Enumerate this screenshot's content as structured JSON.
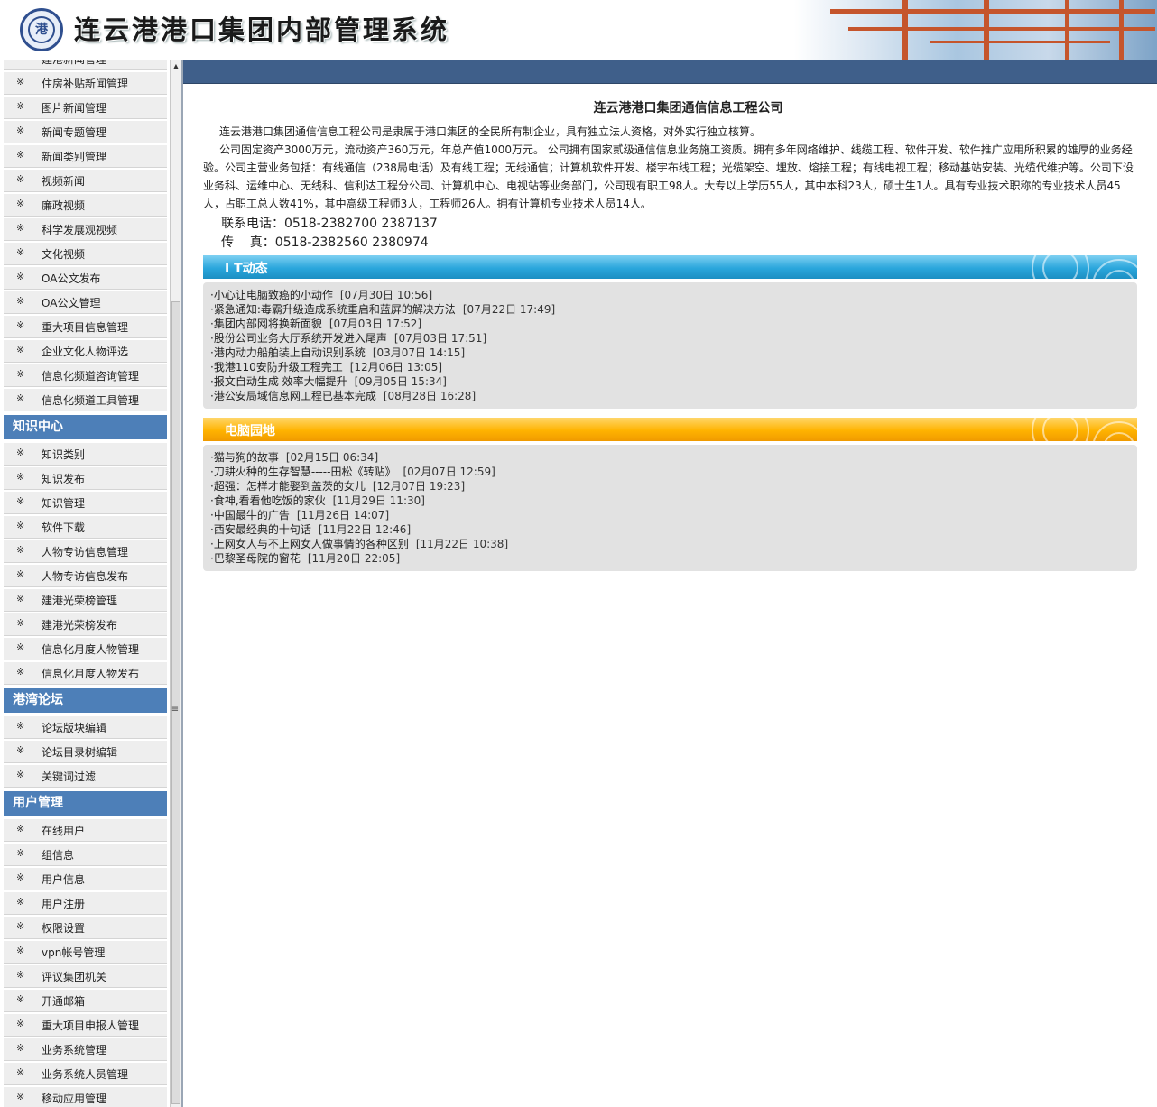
{
  "header": {
    "site_title": "连云港港口集团内部管理系统"
  },
  "sidebar": {
    "group1_items": [
      {
        "label": "建港新闻管理"
      },
      {
        "label": "住房补贴新闻管理"
      },
      {
        "label": "图片新闻管理"
      },
      {
        "label": "新闻专题管理"
      },
      {
        "label": "新闻类别管理"
      },
      {
        "label": "视频新闻"
      },
      {
        "label": "廉政视频"
      },
      {
        "label": "科学发展观视频"
      },
      {
        "label": "文化视频"
      },
      {
        "label": "OA公文发布"
      },
      {
        "label": "OA公文管理"
      },
      {
        "label": "重大项目信息管理"
      },
      {
        "label": "企业文化人物评选"
      },
      {
        "label": "信息化频道咨询管理"
      },
      {
        "label": "信息化频道工具管理"
      }
    ],
    "knowledge_header": "知识中心",
    "knowledge_items": [
      {
        "label": "知识类别"
      },
      {
        "label": "知识发布"
      },
      {
        "label": "知识管理"
      },
      {
        "label": "软件下载"
      },
      {
        "label": "人物专访信息管理"
      },
      {
        "label": "人物专访信息发布"
      },
      {
        "label": "建港光荣榜管理"
      },
      {
        "label": "建港光荣榜发布"
      },
      {
        "label": "信息化月度人物管理"
      },
      {
        "label": "信息化月度人物发布"
      }
    ],
    "forum_header": "港湾论坛",
    "forum_items": [
      {
        "label": "论坛版块编辑"
      },
      {
        "label": "论坛目录树编辑"
      },
      {
        "label": "关键词过滤"
      }
    ],
    "users_header": "用户管理",
    "users_items": [
      {
        "label": "在线用户"
      },
      {
        "label": "组信息"
      },
      {
        "label": "用户信息"
      },
      {
        "label": "用户注册"
      },
      {
        "label": "权限设置"
      },
      {
        "label": "vpn帐号管理"
      },
      {
        "label": "评议集团机关"
      },
      {
        "label": "开通邮箱"
      },
      {
        "label": "重大项目申报人管理"
      },
      {
        "label": "业务系统管理"
      },
      {
        "label": "业务系统人员管理"
      },
      {
        "label": "移动应用管理"
      }
    ],
    "bullet": "※"
  },
  "main": {
    "company_title": "连云港港口集团通信信息工程公司",
    "intro_p1": "连云港港口集团通信信息工程公司是隶属于港口集团的全民所有制企业，具有独立法人资格，对外实行独立核算。",
    "intro_p2": "公司固定资产3000万元，流动资产360万元，年总产值1000万元。 公司拥有国家贰级通信信息业务施工资质。拥有多年网络维护、线缆工程、软件开发、软件推广应用所积累的雄厚的业务经验。公司主营业务包括：有线通信（238局电话）及有线工程；无线通信；计算机软件开发、楼宇布线工程；光缆架空、埋放、熔接工程；有线电视工程；移动基站安装、光缆代维护等。公司下设业务科、运维中心、无线科、信利达工程分公司、计算机中心、电视站等业务部门，公司现有职工98人。大专以上学历55人，其中本科23人，硕士生1人。具有专业技术职称的专业技术人员45人，占职工总人数41%，其中高级工程师3人，工程师26人。拥有计算机专业技术人员14人。",
    "phone": "联系电话：0518-2382700 2387137",
    "fax": "传    真：0518-2382560 2380974",
    "it_section_title": "I T动态",
    "it_news": [
      {
        "title": "·小心让电脑致癌的小动作",
        "date": "[07月30日 10:56]"
      },
      {
        "title": "·紧急通知:毒霸升级造成系统重启和蓝屏的解决方法",
        "date": "[07月22日 17:49]"
      },
      {
        "title": "·集团内部网将换新面貌",
        "date": "[07月03日 17:52]"
      },
      {
        "title": "·股份公司业务大厅系统开发进入尾声",
        "date": "[07月03日 17:51]"
      },
      {
        "title": "·港内动力船舶装上自动识别系统",
        "date": "[03月07日 14:15]"
      },
      {
        "title": "·我港110安防升级工程完工",
        "date": "[12月06日 13:05]"
      },
      {
        "title": "·报文自动生成 效率大幅提升",
        "date": "[09月05日 15:34]"
      },
      {
        "title": "·港公安局域信息网工程已基本完成",
        "date": "[08月28日 16:28]"
      }
    ],
    "pc_section_title": "电脑园地",
    "pc_news": [
      {
        "title": "·猫与狗的故事",
        "date": "[02月15日 06:34]"
      },
      {
        "title": "·刀耕火种的生存智慧-----田松《转贴》",
        "date": "[02月07日 12:59]"
      },
      {
        "title": "·超强：怎样才能娶到盖茨的女儿",
        "date": "[12月07日 19:23]"
      },
      {
        "title": "·食神,看看他吃饭的家伙",
        "date": "[11月29日 11:30]"
      },
      {
        "title": "·中国最牛的广告",
        "date": "[11月26日 14:07]"
      },
      {
        "title": "·西安最经典的十句话",
        "date": "[11月22日 12:46]"
      },
      {
        "title": "·上网女人与不上网女人做事情的各种区别",
        "date": "[11月22日 10:38]"
      },
      {
        "title": "·巴黎圣母院的窗花",
        "date": "[11月20日 22:05]"
      }
    ]
  },
  "colors": {
    "topbar": "#3f5f8a",
    "menu_header": "#4d7fb8",
    "it_bar": "#2aa6dc",
    "pc_bar": "#ffb300",
    "news_box": "#e2e2e2"
  }
}
